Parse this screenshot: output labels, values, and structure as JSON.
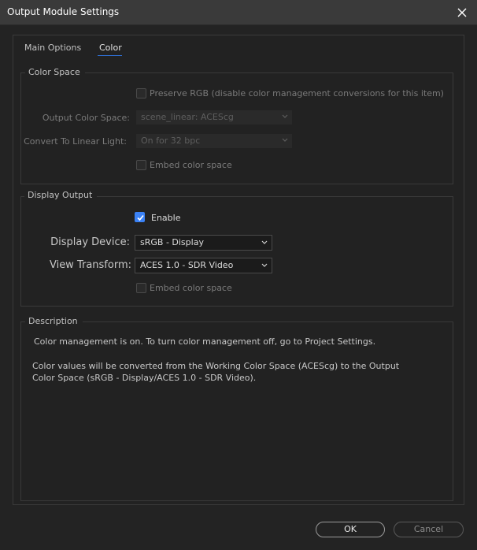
{
  "window": {
    "title": "Output Module Settings"
  },
  "tabs": [
    {
      "label": "Main Options"
    },
    {
      "label": "Color"
    }
  ],
  "color_space": {
    "group_label": "Color Space",
    "preserve_rgb_label": "Preserve RGB (disable color management conversions for this item)",
    "output_color_space_label": "Output Color Space:",
    "output_color_space_value": "scene_linear: ACEScg",
    "convert_linear_label": "Convert To Linear Light:",
    "convert_linear_value": "On for 32 bpc",
    "embed_label": "Embed color space"
  },
  "display_output": {
    "group_label": "Display Output",
    "enable_label": "Enable",
    "display_device_label": "Display Device:",
    "display_device_value": "sRGB - Display",
    "view_transform_label": "View Transform:",
    "view_transform_value": "ACES 1.0 - SDR Video",
    "embed_label": "Embed color space"
  },
  "description": {
    "group_label": "Description",
    "line1": "Color management is on. To turn color management off, go to Project Settings.",
    "line2": "Color values will be converted from the Working Color Space (ACEScg) to the Output",
    "line3": "Color Space (sRGB - Display/ACES 1.0 - SDR Video)."
  },
  "buttons": {
    "ok": "OK",
    "cancel": "Cancel"
  },
  "colors": {
    "accent": "#3b82f6",
    "background": "#232323",
    "titlebar": "#3a3a3a"
  }
}
